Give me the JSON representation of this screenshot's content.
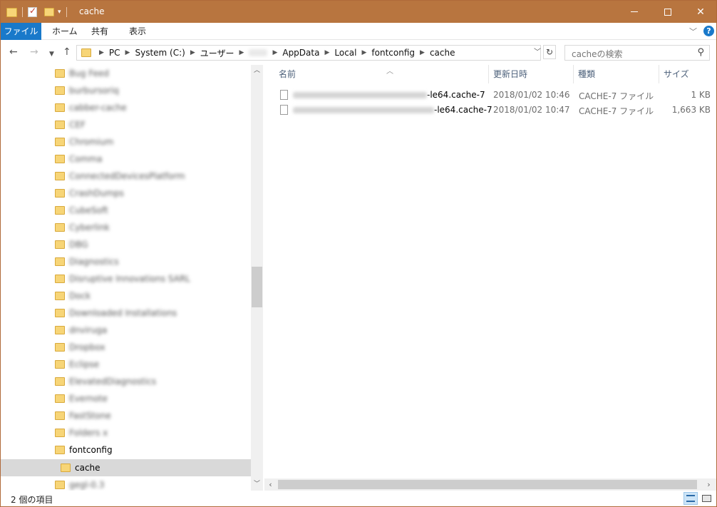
{
  "window": {
    "title": "cache"
  },
  "ribbon": {
    "tabs": [
      "ファイル",
      "ホーム",
      "共有",
      "表示"
    ]
  },
  "address": {
    "crumbs": [
      "PC",
      "System (C:)",
      "ユーザー",
      "AppData",
      "Local",
      "fontconfig",
      "cache"
    ]
  },
  "search": {
    "placeholder": "cacheの検索"
  },
  "tree": {
    "blurred_items": [
      "Bug Feed",
      "burbursoriq",
      "cabber-cache",
      "CEF",
      "Chromium",
      "Comma",
      "ConnectedDevicesPlatform",
      "CrashDumps",
      "CubeSoft",
      "Cyberlink",
      "DBG",
      "Diagnostics",
      "Disruptive Innovations SARL",
      "Dock",
      "Downloaded Installations",
      "dnviruga",
      "Dropbox",
      "Eclipse",
      "ElevatedDiagnostics",
      "Evernote",
      "FastStone",
      "Folders x"
    ],
    "fontconfig": "fontconfig",
    "cache": "cache",
    "after": "gegl-0.3"
  },
  "columns": {
    "name": "名前",
    "date": "更新日時",
    "type": "種類",
    "size": "サイズ"
  },
  "files": [
    {
      "name_suffix": "-le64.cache-7",
      "date": "2018/01/02 10:46",
      "type": "CACHE-7 ファイル",
      "size": "1 KB"
    },
    {
      "name_suffix": "-le64.cache-7",
      "date": "2018/01/02 10:47",
      "type": "CACHE-7 ファイル",
      "size": "1,663 KB"
    }
  ],
  "status": {
    "count_text": "2 個の項目"
  },
  "colors": {
    "titlebar": "#b8753f",
    "file_tab": "#1979ca",
    "selection": "#d9d9d9"
  }
}
